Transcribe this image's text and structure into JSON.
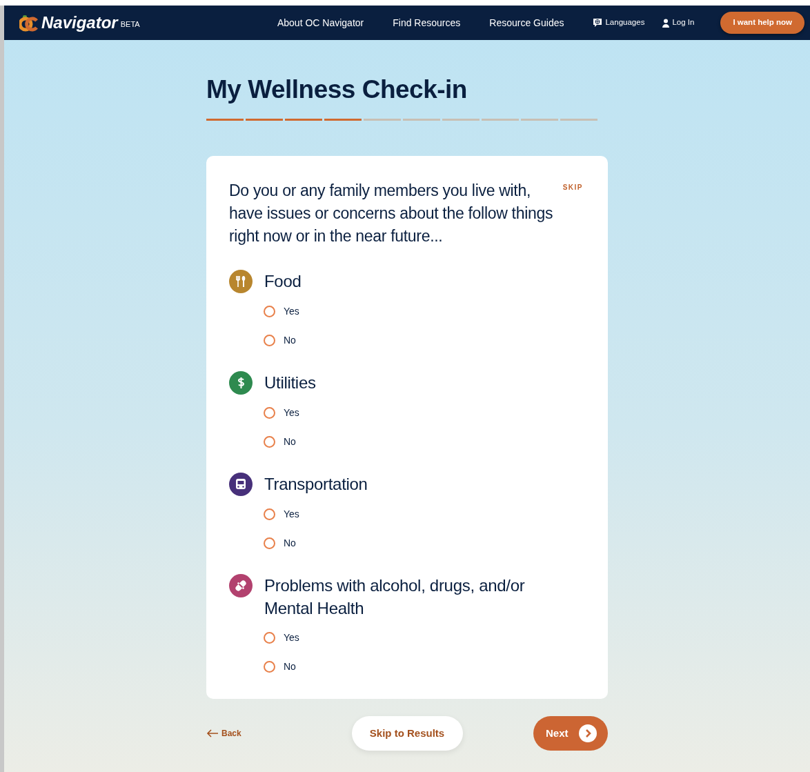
{
  "navbar": {
    "brand": "Navigator",
    "badge": "BETA",
    "links": [
      "About OC Navigator",
      "Find Resources",
      "Resource Guides"
    ],
    "languages": "Languages",
    "login": "Log In",
    "help_button": "I want help now"
  },
  "title": "My Wellness Check-in",
  "progress": [
    {
      "completed": true
    },
    {
      "completed": true
    },
    {
      "completed": true
    },
    {
      "completed": true
    },
    {
      "completed": false
    },
    {
      "completed": false
    },
    {
      "completed": false
    },
    {
      "completed": false
    },
    {
      "completed": false
    },
    {
      "completed": false
    }
  ],
  "question": {
    "text": "Do you or any family members you live with, have issues or concerns about the follow things right now or in the near future...",
    "skip": "SKIP",
    "topics": [
      {
        "kind": "food",
        "label": "Food",
        "color": "#b8862e",
        "options": [
          {
            "label": "Yes",
            "selected": false
          },
          {
            "label": "No",
            "selected": false
          }
        ]
      },
      {
        "kind": "money",
        "label": "Utilities",
        "color": "#2e8a4f",
        "options": [
          {
            "label": "Yes",
            "selected": false
          },
          {
            "label": "No",
            "selected": false
          }
        ]
      },
      {
        "kind": "bus",
        "label": "Transportation",
        "color": "#47307a",
        "options": [
          {
            "label": "Yes",
            "selected": false
          },
          {
            "label": "No",
            "selected": false
          }
        ]
      },
      {
        "kind": "pill",
        "label": "Problems with alcohol,  drugs, and/or Mental Health",
        "color": "#b2416e",
        "options": [
          {
            "label": "Yes",
            "selected": false
          },
          {
            "label": "No",
            "selected": false
          }
        ]
      }
    ]
  },
  "footer": {
    "back": "Back",
    "skip_results": "Skip to Results",
    "next": "Next"
  }
}
